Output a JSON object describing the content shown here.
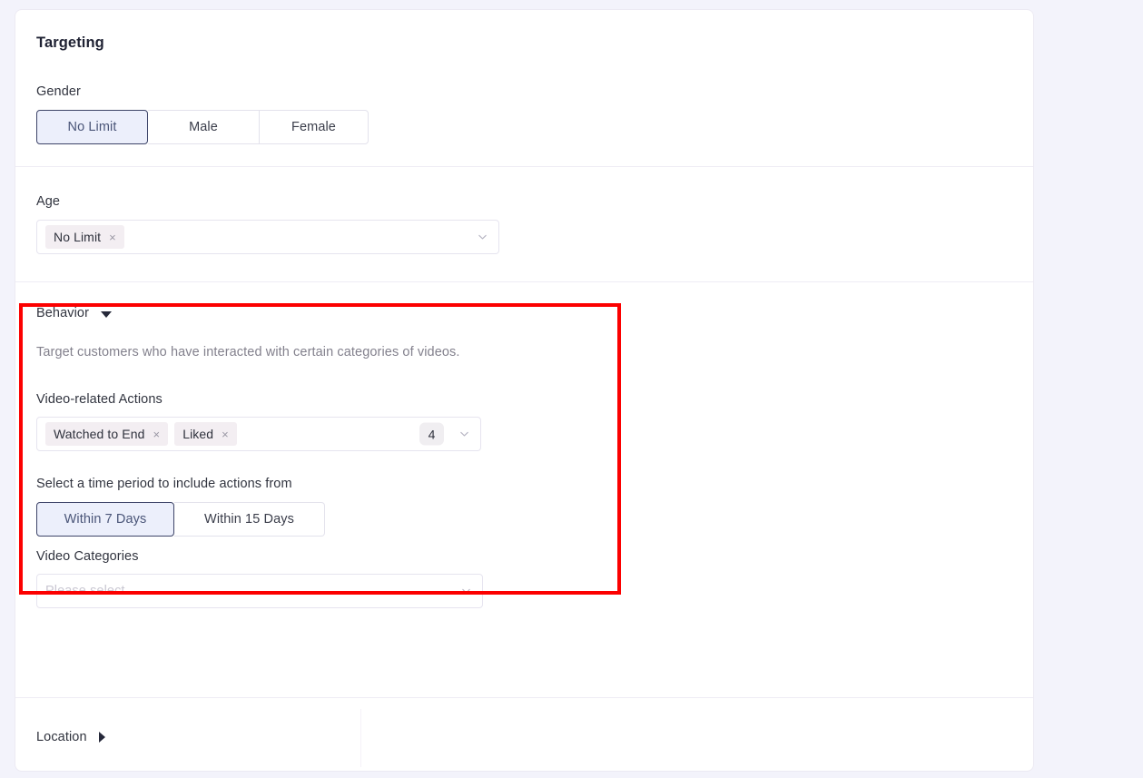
{
  "card": {
    "title": "Targeting"
  },
  "gender": {
    "label": "Gender",
    "options": [
      {
        "label": "No Limit",
        "selected": true
      },
      {
        "label": "Male",
        "selected": false
      },
      {
        "label": "Female",
        "selected": false
      }
    ]
  },
  "age": {
    "label": "Age",
    "tags": [
      {
        "label": "No Limit",
        "remove": "×"
      }
    ]
  },
  "behavior": {
    "label": "Behavior",
    "expanded": true,
    "toggle_icon": "triangle-down-icon",
    "description": "Target customers who have interacted with certain categories of videos.",
    "actions": {
      "label": "Video-related Actions",
      "tags": [
        {
          "label": "Watched to End",
          "remove": "×"
        },
        {
          "label": "Liked",
          "remove": "×"
        }
      ],
      "count": "4"
    },
    "time_period": {
      "label": "Select a time period to include actions from",
      "options": [
        {
          "label": "Within 7 Days",
          "selected": true
        },
        {
          "label": "Within 15 Days",
          "selected": false
        }
      ]
    }
  },
  "video_categories": {
    "label": "Video Categories",
    "placeholder": "Please select",
    "value": ""
  },
  "location": {
    "label": "Location",
    "expanded": false,
    "toggle_icon": "triangle-right-icon"
  },
  "colors": {
    "page_background": "#f3f3fb",
    "card_background": "#ffffff",
    "selected_fill": "#eceffb",
    "selected_border": "#3d4468",
    "tag_background": "#f3eef2",
    "highlight_border": "#fc0000",
    "divider": "#eeecf4"
  }
}
